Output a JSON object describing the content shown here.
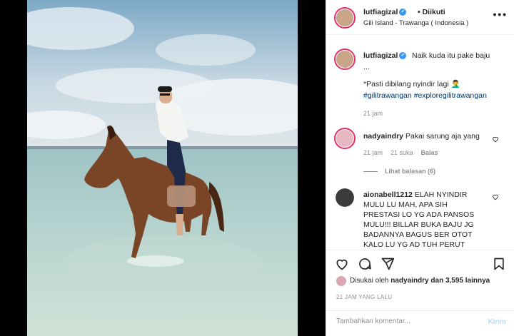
{
  "post": {
    "username": "lutfiagizal",
    "follow_status": "Diikuti",
    "location": "Gili Island - Trawanga ( Indonesia )",
    "more_icon": "more-horizontal-icon"
  },
  "caption": {
    "username": "lutfiagizal",
    "text_line1": "Naik kuda itu pake baju",
    "text_line2": "...",
    "text_line3": "*Pasti dibilang nyindir lagi 🤦‍♂️",
    "hashtags": "#gilitrawangan #exploregilitrawangan",
    "time": "21 jam"
  },
  "comments": [
    {
      "username": "nadyaindry",
      "text": "Pakai sarung aja yang",
      "time": "21 jam",
      "likes": "21 suka",
      "reply": "Balas",
      "view_replies": "Lihat balasan (6)"
    },
    {
      "username": "aionabell1212",
      "text": "ELAH NYINDIR MULU LU MAH, APA SIH PRESTASI LO YG ADA PANSOS MULU!!! BILLAR BUKA BAJU JG BADANNYA BAGUS BER OTOT KALO LU YG AD TUH PERUT"
    }
  ],
  "actions": {
    "liked_by_prefix": "Disukai oleh",
    "liked_by_user": "nadyaindry",
    "liked_by_suffix": "dan 3,595 lainnya",
    "timestamp": "21 JAM YANG LALU"
  },
  "add_comment": {
    "placeholder": "Tambahkan komentar...",
    "send_label": "Kirim"
  },
  "colors": {
    "accent": "#3897f0",
    "hashtag": "#00376b",
    "muted": "#8e8e8e",
    "send_disabled": "#b2dffc"
  }
}
